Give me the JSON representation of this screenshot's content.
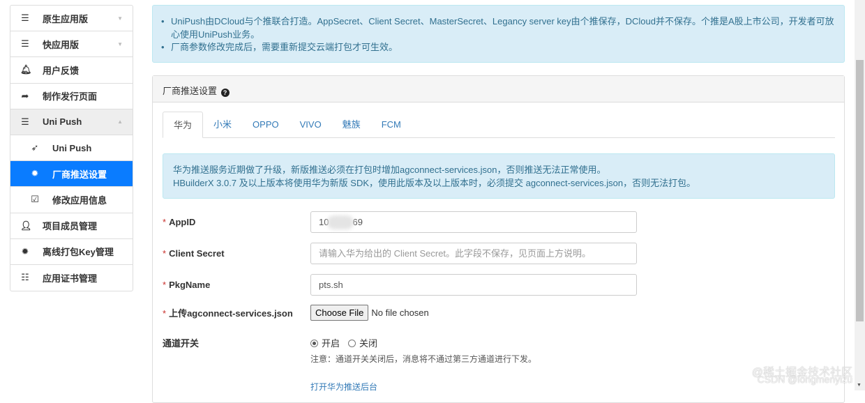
{
  "sidebar": {
    "items": [
      {
        "label": "原生应用版",
        "icon": "bars-icon"
      },
      {
        "label": "快应用版",
        "icon": "bars-icon"
      },
      {
        "label": "用户反馈",
        "icon": "bell-icon"
      },
      {
        "label": "制作发行页面",
        "icon": "share-icon"
      },
      {
        "label": "Uni Push",
        "icon": "bars-icon"
      },
      {
        "label": "Uni Push",
        "icon": "paper-plane-icon"
      },
      {
        "label": "厂商推送设置",
        "icon": "gear-icon"
      },
      {
        "label": "修改应用信息",
        "icon": "edit-icon"
      },
      {
        "label": "项目成员管理",
        "icon": "user-icon"
      },
      {
        "label": "离线打包Key管理",
        "icon": "gear-icon"
      },
      {
        "label": "应用证书管理",
        "icon": "list-icon"
      }
    ]
  },
  "alert": {
    "items": [
      "UniPush由DCloud与个推联合打造。AppSecret、Client Secret、MasterSecret、Legancy server key由个推保存，DCloud并不保存。个推是A股上市公司，开发者可放心使用UniPush业务。",
      "厂商参数修改完成后，需要重新提交云端打包才可生效。"
    ]
  },
  "panel": {
    "title": "厂商推送设置",
    "tabs": [
      "华为",
      "小米",
      "OPPO",
      "VIVO",
      "魅族",
      "FCM"
    ],
    "info": [
      "华为推送服务近期做了升级，新版推送必须在打包时增加agconnect-services.json，否则推送无法正常使用。",
      "HBuilderX 3.0.7 及以上版本将使用华为新版 SDK，使用此版本及以上版本时，必须提交 agconnect-services.json，否则无法打包。"
    ],
    "form": {
      "appid_label": "AppID",
      "appid_prefix": "10",
      "appid_suffix": "69",
      "secret_label": "Client Secret",
      "secret_placeholder": "请输入华为给出的 Client Secret。此字段不保存，见页面上方说明。",
      "pkg_label": "PkgName",
      "pkg_value": "pts.sh",
      "file_label": "上传agconnect-services.json",
      "file_button": "Choose File",
      "file_status": "No file chosen",
      "switch_label": "通道开关",
      "switch_on": "开启",
      "switch_off": "关闭",
      "note": "注意：通道开关关闭后，消息将不通过第三方通道进行下发。",
      "link": "打开华为推送后台"
    }
  },
  "watermark": {
    "line1": "@稀土掘金技术社区",
    "line2": "CSDN @longmenyizu"
  }
}
